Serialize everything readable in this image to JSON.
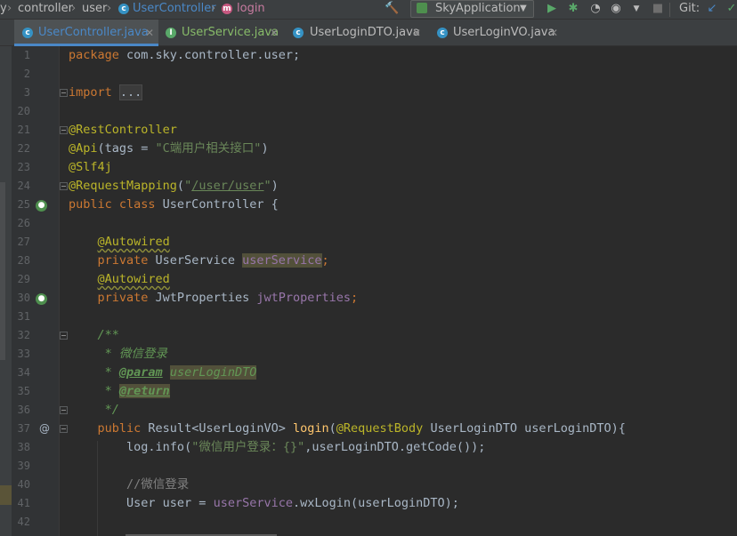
{
  "breadcrumb": {
    "items": [
      "controller",
      "user",
      "UserController",
      "login"
    ],
    "leading": "y"
  },
  "toolbar": {
    "run_config": "SkyApplication",
    "git_label": "Git:"
  },
  "colors": {
    "background": "#2b2b2b",
    "keyword": "#cc7832",
    "annotation": "#bbb529",
    "string": "#6a8759",
    "field": "#9876aa",
    "doc_comment": "#629755",
    "method": "#ffc66d",
    "active_tab_underline": "#4a88c7"
  },
  "tabs": [
    {
      "label": "UserController.java",
      "icon": "class-icon",
      "active": true
    },
    {
      "label": "UserService.java",
      "icon": "interface-icon",
      "active": false
    },
    {
      "label": "UserLoginDTO.java",
      "icon": "class-icon",
      "active": false
    },
    {
      "label": "UserLoginVO.java",
      "icon": "class-icon",
      "active": false
    }
  ],
  "editor": {
    "line_numbers": [
      "1",
      "2",
      "3",
      "20",
      "21",
      "22",
      "23",
      "24",
      "25",
      "26",
      "27",
      "28",
      "29",
      "30",
      "31",
      "32",
      "33",
      "34",
      "35",
      "36",
      "37",
      "38",
      "39",
      "40",
      "41",
      "42"
    ],
    "code": {
      "l1_kw": "package",
      "l1_rest": " com.sky.controller.user;",
      "l3_kw": "import",
      "l3_fold": "...",
      "l21": "@RestController",
      "l22_an": "@Api",
      "l22_a": "(tags = ",
      "l22_str": "\"C端用户相关接口\"",
      "l22_b": ")",
      "l23": "@Slf4j",
      "l24_an": "@RequestMapping",
      "l24_a": "(",
      "l24_q1": "\"",
      "l24_url": "/user/user",
      "l24_q2": "\"",
      "l24_b": ")",
      "l25_kw": "public class",
      "l25_rest": " UserController {",
      "l27": "@Autowired",
      "l28_kw": "private",
      "l28_type": " UserService ",
      "l28_field": "userService",
      "l28_semi": ";",
      "l29": "@Autowired",
      "l30_kw": "private",
      "l30_type": " JwtProperties ",
      "l30_field": "jwtProperties",
      "l30_semi": ";",
      "l32": "/**",
      "l33": " * 微信登录",
      "l34_star": " * ",
      "l34_tag": "@param",
      "l34_sp": " ",
      "l34_val": "userLoginDTO",
      "l35_star": " * ",
      "l35_tag": "@return",
      "l36": " */",
      "l37_kw": "public",
      "l37_a": " Result<UserLoginVO> ",
      "l37_fn": "login",
      "l37_b": "(",
      "l37_an": "@RequestBody",
      "l37_c": " UserLoginDTO userLoginDTO){",
      "l38_a": "log.",
      "l38_fn": "info",
      "l38_b": "(",
      "l38_str": "\"微信用户登录：{}\"",
      "l38_c": ",userLoginDTO.getCode());",
      "l40": "//微信登录",
      "l41_a": "User user = ",
      "l41_field": "userService",
      "l41_b": ".wxLogin(userLoginDTO);"
    }
  }
}
